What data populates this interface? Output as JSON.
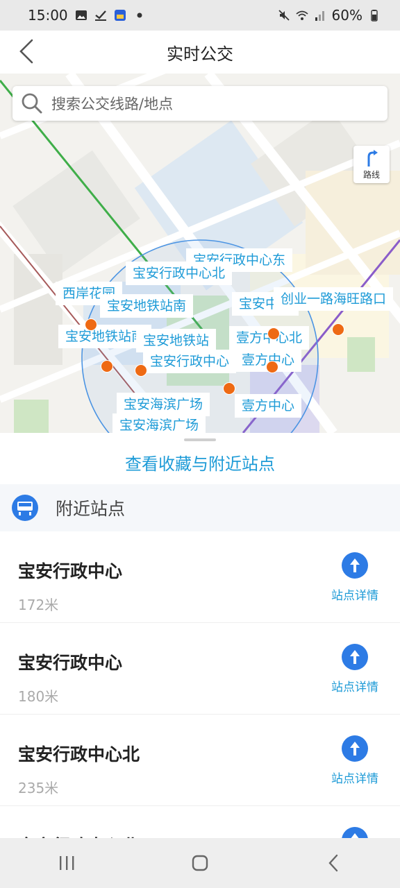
{
  "status_bar": {
    "time": "15:00",
    "battery": "60%"
  },
  "header": {
    "title": "实时公交"
  },
  "search": {
    "placeholder": "搜索公交线路/地点"
  },
  "route_button": {
    "label": "路线"
  },
  "map_labels": [
    "宝安行政中心东",
    "宝安行政中心北",
    "西岸花园",
    "宝安地铁站南",
    "宝安中心",
    "创业一路海旺路口",
    "宝安地铁站南",
    "宝安地铁站",
    "壹方中心北",
    "宝安行政中心",
    "壹方中心",
    "宝安海滨广场",
    "壹方中心",
    "宝安海滨广场"
  ],
  "sheet": {
    "favorites_link": "查看收藏与附近站点"
  },
  "nearby": {
    "title": "附近站点",
    "stops": [
      {
        "name": "宝安行政中心",
        "distance": "172米",
        "detail_label": "站点详情"
      },
      {
        "name": "宝安行政中心",
        "distance": "180米",
        "detail_label": "站点详情"
      },
      {
        "name": "宝安行政中心北",
        "distance": "235米",
        "detail_label": "站点详情"
      },
      {
        "name": "宝安行政中心北",
        "distance": "",
        "detail_label": ""
      }
    ]
  },
  "colors": {
    "accent": "#1e9bd7",
    "stop_dot": "#ee6a14",
    "nav_blue": "#2d7be5"
  },
  "icons": [
    "back-arrow-icon",
    "search-icon",
    "route-icon",
    "bus-stop-icon",
    "navigate-arrow-icon",
    "recent-apps-icon",
    "home-icon",
    "nav-back-icon"
  ]
}
